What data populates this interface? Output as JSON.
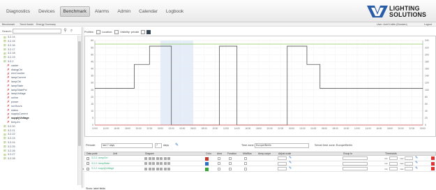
{
  "nav": {
    "items": [
      {
        "label": "Diagnostics",
        "active": false
      },
      {
        "label": "Devices",
        "active": false
      },
      {
        "label": "Benchmark",
        "active": true
      },
      {
        "label": "Alarms",
        "active": false
      },
      {
        "label": "Admin",
        "active": false
      },
      {
        "label": "Calendar",
        "active": false
      },
      {
        "label": "Logbook",
        "active": false
      }
    ]
  },
  "logo": {
    "line1": "LIGHTING",
    "line2": "SOLUTIONS",
    "brand_color": "#2a5ca8"
  },
  "subbar": {
    "left": [
      "Benchmark",
      "Trend Assist",
      "Energy Summary"
    ],
    "user_text": "User: Axel Kullek (Brosken)",
    "logout": "Logout"
  },
  "sidebar": {
    "search_label": "Search:",
    "search_value": "",
    "items": [
      {
        "label": "3.2.14",
        "kind": "node",
        "indent": 0
      },
      {
        "label": "3.2.15",
        "kind": "node",
        "indent": 0
      },
      {
        "label": "3.2.16",
        "kind": "node",
        "indent": 0
      },
      {
        "label": "3.2.17",
        "kind": "node",
        "indent": 0
      },
      {
        "label": "3.2.18",
        "kind": "node",
        "indent": 0
      },
      {
        "label": "3.2.19",
        "kind": "node",
        "indent": 0
      },
      {
        "label": "3.2.2",
        "kind": "node",
        "indent": 0
      },
      {
        "label": "caster",
        "kind": "leaf",
        "indent": 1
      },
      {
        "label": "dialogCtrl",
        "kind": "leaf",
        "indent": 1
      },
      {
        "label": "envCounter",
        "kind": "leaf",
        "indent": 1
      },
      {
        "label": "lampCurrent",
        "kind": "leaf",
        "indent": 1
      },
      {
        "label": "lampCtrl",
        "kind": "leaf",
        "indent": 1
      },
      {
        "label": "lampState",
        "kind": "leaf",
        "indent": 1
      },
      {
        "label": "lampStatePct",
        "kind": "leaf",
        "indent": 1
      },
      {
        "label": "lampVoltage",
        "kind": "leaf",
        "indent": 1
      },
      {
        "label": "online",
        "kind": "leaf",
        "indent": 1
      },
      {
        "label": "power",
        "kind": "leaf",
        "indent": 1
      },
      {
        "label": "runHours",
        "kind": "leaf",
        "indent": 1
      },
      {
        "label": "status",
        "kind": "leaf",
        "indent": 1
      },
      {
        "label": "supplyCurrent",
        "kind": "leaf",
        "indent": 1
      },
      {
        "label": "supplyVoltage",
        "kind": "leaf",
        "indent": 1,
        "selected": true
      },
      {
        "label": "temp/m",
        "kind": "leaf",
        "indent": 1
      },
      {
        "label": "3.2.20",
        "kind": "node",
        "indent": 0
      },
      {
        "label": "3.2.21",
        "kind": "node",
        "indent": 0
      },
      {
        "label": "3.2.22",
        "kind": "node",
        "indent": 0
      },
      {
        "label": "3.2.23",
        "kind": "node",
        "indent": 0
      },
      {
        "label": "3.2.24",
        "kind": "node",
        "indent": 0
      },
      {
        "label": "3.2.25",
        "kind": "node",
        "indent": 0
      },
      {
        "label": "3.2.26",
        "kind": "node",
        "indent": 0
      },
      {
        "label": "3.2.27",
        "kind": "node",
        "indent": 0
      },
      {
        "label": "3.2.28",
        "kind": "node",
        "indent": 0
      }
    ]
  },
  "toolbar": {
    "profiles_label": "Profiles:",
    "location_label": "Location:",
    "visibility_label": "Visibility: private"
  },
  "chart_data": {
    "type": "line",
    "x_ticks": [
      "12:00",
      "14:00",
      "16:00",
      "18:00",
      "20:00",
      "22:00",
      "00:00",
      "02:00",
      "04:00",
      "06:00",
      "08:00",
      "10:00",
      "12:00",
      "14:00",
      "16:00",
      "18:00",
      "20:00",
      "22:00",
      "00:00",
      "02:00",
      "04:00",
      "06:00",
      "08:00",
      "10:00",
      "12:00",
      "14:00",
      "16:00",
      "18:00",
      "20:00",
      "22:00",
      "00:00"
    ],
    "y_left_ticks": [
      "0",
      "5",
      "10",
      "15",
      "20",
      "25",
      "30",
      "35",
      "40",
      "45",
      "50",
      "55",
      "60"
    ],
    "y_right_ticks": [
      "0",
      "20",
      "40",
      "60",
      "80",
      "100",
      "120",
      "140",
      "160",
      "180",
      "200",
      "220",
      "240"
    ],
    "highlight_range": [
      "00:00",
      "06:00"
    ],
    "series": [
      {
        "color": "#7fbf3f",
        "axis": "right",
        "values": [
          230,
          230,
          230,
          230,
          230,
          230,
          230,
          230,
          230,
          230,
          230,
          230,
          230,
          230,
          230,
          230,
          230,
          230,
          230,
          230,
          230,
          230,
          230,
          230,
          230,
          230,
          230,
          230,
          230,
          230,
          230
        ]
      },
      {
        "color": "#555555",
        "axis": "left",
        "steps": [
          {
            "x": 0,
            "y": 26
          },
          {
            "x": 3.6,
            "y": 26
          },
          {
            "x": 3.6,
            "y": 43
          },
          {
            "x": 5.0,
            "y": 43
          },
          {
            "x": 5.0,
            "y": 56
          },
          {
            "x": 7.0,
            "y": 56
          },
          {
            "x": 7.0,
            "y": 0
          },
          {
            "x": 11.4,
            "y": 0
          },
          {
            "x": 11.4,
            "y": 56
          },
          {
            "x": 13.0,
            "y": 56
          },
          {
            "x": 13.0,
            "y": 0
          },
          {
            "x": 17.6,
            "y": 0
          },
          {
            "x": 17.6,
            "y": 56
          },
          {
            "x": 19.4,
            "y": 56
          },
          {
            "x": 19.4,
            "y": 43
          },
          {
            "x": 20.6,
            "y": 43
          },
          {
            "x": 20.6,
            "y": 26
          },
          {
            "x": 30,
            "y": 26
          }
        ]
      },
      {
        "color": "#e05a5a",
        "axis": "left",
        "values": [
          0,
          0,
          0,
          0,
          0,
          0,
          0,
          0,
          0,
          0,
          0,
          0,
          0,
          0,
          0,
          0,
          0,
          0,
          0,
          0,
          0,
          0,
          0,
          0,
          0,
          0,
          0,
          0,
          0,
          0,
          0
        ]
      }
    ]
  },
  "period": {
    "label": "Periode:",
    "value": "last 7 days",
    "count_value": "7",
    "count_unit": "days",
    "timezone_label": "Time zone:",
    "timezone_value": "Europe/Berlin",
    "server_tz_text": "Server time zone: Europe/Berlin"
  },
  "table": {
    "headers": [
      "Data point",
      "Unit",
      "Diagram",
      "Color",
      "Area",
      "Function",
      "Min/Max",
      "Array scope",
      "Adjust scale",
      "Group to",
      "Thresholds"
    ],
    "rows": [
      {
        "name": "3.2.2: lampCtrl",
        "color": "#c0392b"
      },
      {
        "name": "3.2.2: lampState",
        "color": "#2a6fc9"
      },
      {
        "name": "3.2.2: supplyVoltage",
        "color": "#3aa63a"
      }
    ],
    "min_label": "min",
    "max_label": "max",
    "show_all": "Show: label fields"
  }
}
